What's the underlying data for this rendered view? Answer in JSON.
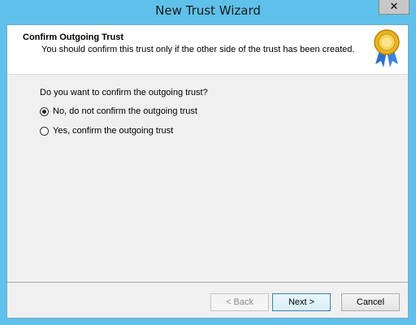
{
  "window": {
    "title": "New Trust Wizard",
    "close_glyph": "✕"
  },
  "header": {
    "title": "Confirm Outgoing Trust",
    "subtitle": "You should confirm this trust only if the other side of the trust has been created.",
    "icon": "award-ribbon-icon"
  },
  "main": {
    "question": "Do you want to confirm the outgoing trust?",
    "options": [
      {
        "label": "No, do not confirm the outgoing trust",
        "checked": true
      },
      {
        "label": "Yes, confirm the outgoing trust",
        "checked": false
      }
    ]
  },
  "buttons": {
    "back": "< Back",
    "next": "Next >",
    "cancel": "Cancel"
  },
  "colors": {
    "titlebar": "#5fc1ea",
    "client": "#f0f0f0"
  }
}
